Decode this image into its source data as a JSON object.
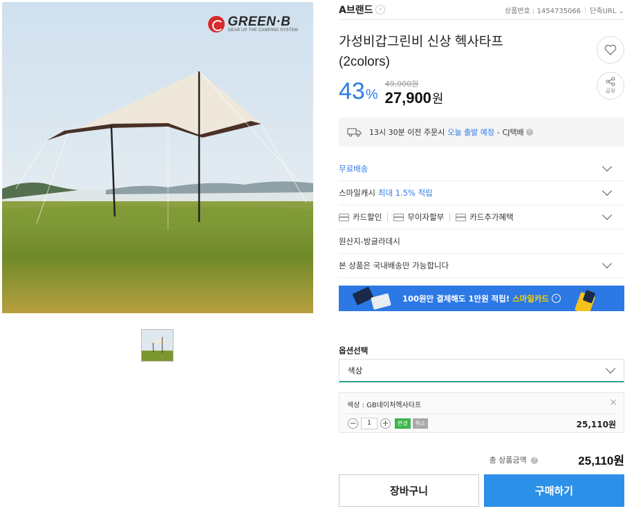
{
  "header": {
    "brand": "A브랜드",
    "brand_arrow": "›",
    "product_no_label": "상품번호 : 1454735066",
    "short_url": "단축URL",
    "short_url_arrow": "⌄"
  },
  "product": {
    "title_line1": "가성비갑그린비 신상 헥사타프",
    "title_line2": "(2colors)",
    "discount": "43",
    "discount_unit": "%",
    "original_price": "49,000원",
    "price": "27,900",
    "price_unit": "원",
    "logo_name": "GREEN·B",
    "logo_slogan": "GEAR UP THE CAMPING SYSTEM"
  },
  "actions": {
    "share_label": "공유"
  },
  "shipping": {
    "text": "13시 30분 이전 주문시",
    "highlight": "오늘 출발 예정",
    "carrier": "- CJ택배"
  },
  "rows": {
    "free_shipping": "무료배송",
    "smile_cash": "스마일캐시",
    "smile_cash_rate": "최대 1.5% 적립",
    "card_discount": "카드할인",
    "installment": "무이자할부",
    "card_benefit": "카드추가혜택",
    "origin": "원산지-방글라데시",
    "domestic": "본 상품은 국내배송만 가능합니다"
  },
  "banner": {
    "text": "100원만 결제해도 1만원 적립!",
    "highlight": "스마일카드",
    "arrow": "›"
  },
  "options": {
    "label": "옵션선택",
    "select_value": "색상",
    "selected_name": "색상 : GB네이처헥사타프",
    "quantity": "1",
    "minus": "−",
    "plus": "+",
    "change": "변경",
    "cancel": "취소",
    "item_price": "25,110원",
    "close": "×"
  },
  "total": {
    "label": "총 상품금액",
    "value": "25,110원"
  },
  "buttons": {
    "cart": "장바구니",
    "buy": "구매하기"
  },
  "colors": {
    "accent_blue": "#2f7be8",
    "buy_button": "#2c8fe8",
    "banner": "#2c78e4",
    "banner_highlight": "#ffd400",
    "select_underline": "#2aa08a"
  }
}
